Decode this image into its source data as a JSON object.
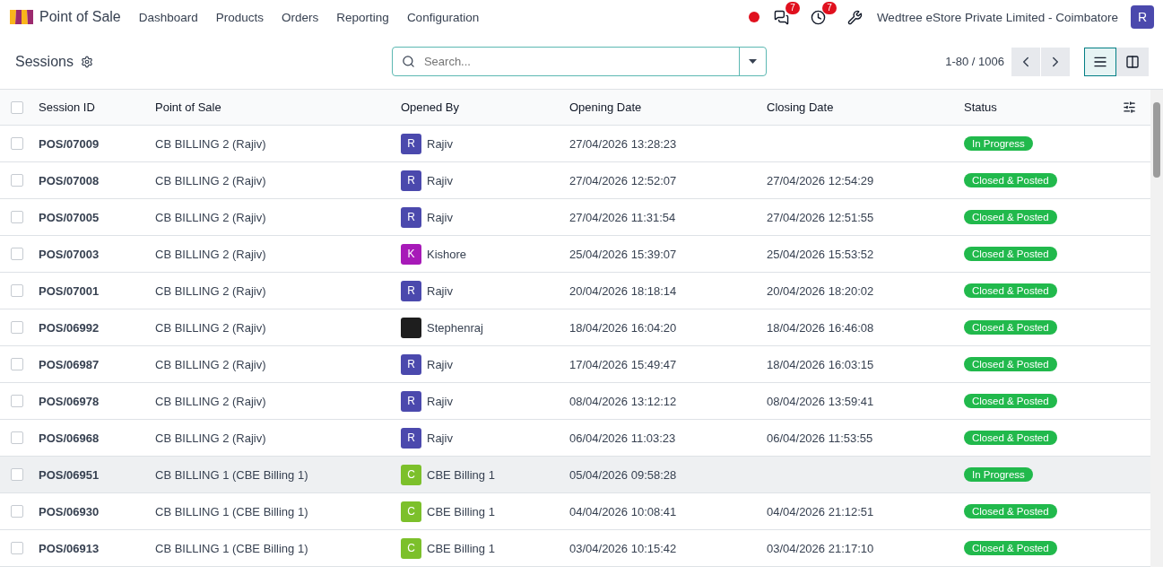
{
  "navbar": {
    "app_name": "Point of Sale",
    "menu": [
      "Dashboard",
      "Products",
      "Orders",
      "Reporting",
      "Configuration"
    ],
    "messages_badge": "7",
    "activities_badge": "7",
    "company": "Wedtree eStore Private Limited - Coimbatore",
    "user_initial": "R"
  },
  "control_panel": {
    "title": "Sessions",
    "search": {
      "placeholder": "Search..."
    },
    "pager": "1-80 / 1006",
    "views": [
      {
        "kind": "list",
        "selected": true
      },
      {
        "kind": "kanban",
        "selected": false
      }
    ]
  },
  "table": {
    "select_all_checked": false,
    "columns": [
      "Session ID",
      "Point of Sale",
      "Opened By",
      "Opening Date",
      "Closing Date",
      "Status"
    ],
    "rows": [
      {
        "id": "POS/07009",
        "pos": "CB BILLING 2 (Rajiv)",
        "avatar": {
          "kind": "letter",
          "initial": "R",
          "color": "#4b49ad"
        },
        "opened_by": "Rajiv",
        "opening": "27/04/2026 13:28:23",
        "closing": "",
        "status": "In Progress",
        "hovered": false,
        "checked": false
      },
      {
        "id": "POS/07008",
        "pos": "CB BILLING 2 (Rajiv)",
        "avatar": {
          "kind": "letter",
          "initial": "R",
          "color": "#4b49ad"
        },
        "opened_by": "Rajiv",
        "opening": "27/04/2026 12:52:07",
        "closing": "27/04/2026 12:54:29",
        "status": "Closed & Posted",
        "hovered": false,
        "checked": false
      },
      {
        "id": "POS/07005",
        "pos": "CB BILLING 2 (Rajiv)",
        "avatar": {
          "kind": "letter",
          "initial": "R",
          "color": "#4b49ad"
        },
        "opened_by": "Rajiv",
        "opening": "27/04/2026 11:31:54",
        "closing": "27/04/2026 12:51:55",
        "status": "Closed & Posted",
        "hovered": false,
        "checked": false
      },
      {
        "id": "POS/07003",
        "pos": "CB BILLING 2 (Rajiv)",
        "avatar": {
          "kind": "letter",
          "initial": "K",
          "color": "#a71ab8"
        },
        "opened_by": "Kishore",
        "opening": "25/04/2026 15:39:07",
        "closing": "25/04/2026 15:53:52",
        "status": "Closed & Posted",
        "hovered": false,
        "checked": false
      },
      {
        "id": "POS/07001",
        "pos": "CB BILLING 2 (Rajiv)",
        "avatar": {
          "kind": "letter",
          "initial": "R",
          "color": "#4b49ad"
        },
        "opened_by": "Rajiv",
        "opening": "20/04/2026 18:18:14",
        "closing": "20/04/2026 18:20:02",
        "status": "Closed & Posted",
        "hovered": false,
        "checked": false
      },
      {
        "id": "POS/06992",
        "pos": "CB BILLING 2 (Rajiv)",
        "avatar": {
          "kind": "image",
          "color": "#1e1e1e"
        },
        "opened_by": "Stephenraj",
        "opening": "18/04/2026 16:04:20",
        "closing": "18/04/2026 16:46:08",
        "status": "Closed & Posted",
        "hovered": false,
        "checked": false
      },
      {
        "id": "POS/06987",
        "pos": "CB BILLING 2 (Rajiv)",
        "avatar": {
          "kind": "letter",
          "initial": "R",
          "color": "#4b49ad"
        },
        "opened_by": "Rajiv",
        "opening": "17/04/2026 15:49:47",
        "closing": "18/04/2026 16:03:15",
        "status": "Closed & Posted",
        "hovered": false,
        "checked": false
      },
      {
        "id": "POS/06978",
        "pos": "CB BILLING 2 (Rajiv)",
        "avatar": {
          "kind": "letter",
          "initial": "R",
          "color": "#4b49ad"
        },
        "opened_by": "Rajiv",
        "opening": "08/04/2026 13:12:12",
        "closing": "08/04/2026 13:59:41",
        "status": "Closed & Posted",
        "hovered": false,
        "checked": false
      },
      {
        "id": "POS/06968",
        "pos": "CB BILLING 2 (Rajiv)",
        "avatar": {
          "kind": "letter",
          "initial": "R",
          "color": "#4b49ad"
        },
        "opened_by": "Rajiv",
        "opening": "06/04/2026 11:03:23",
        "closing": "06/04/2026 11:53:55",
        "status": "Closed & Posted",
        "hovered": false,
        "checked": false
      },
      {
        "id": "POS/06951",
        "pos": "CB BILLING 1 (CBE Billing 1)",
        "avatar": {
          "kind": "letter",
          "initial": "C",
          "color": "#7cc02b"
        },
        "opened_by": "CBE Billing 1",
        "opening": "05/04/2026 09:58:28",
        "closing": "",
        "status": "In Progress",
        "hovered": true,
        "checked": false
      },
      {
        "id": "POS/06930",
        "pos": "CB BILLING 1 (CBE Billing 1)",
        "avatar": {
          "kind": "letter",
          "initial": "C",
          "color": "#7cc02b"
        },
        "opened_by": "CBE Billing 1",
        "opening": "04/04/2026 10:08:41",
        "closing": "04/04/2026 21:12:51",
        "status": "Closed & Posted",
        "hovered": false,
        "checked": false
      },
      {
        "id": "POS/06913",
        "pos": "CB BILLING 1 (CBE Billing 1)",
        "avatar": {
          "kind": "letter",
          "initial": "C",
          "color": "#7cc02b"
        },
        "opened_by": "CBE Billing 1",
        "opening": "03/04/2026 10:15:42",
        "closing": "03/04/2026 21:17:10",
        "status": "Closed & Posted",
        "hovered": false,
        "checked": false
      }
    ]
  }
}
